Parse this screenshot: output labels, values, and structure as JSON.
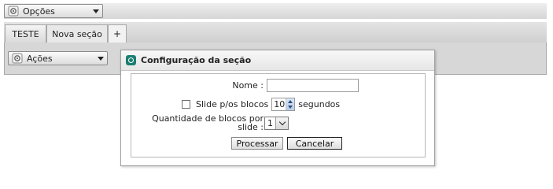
{
  "toolbar": {
    "options_label": "Opções"
  },
  "tabs": [
    {
      "label": "TESTE"
    },
    {
      "label": "Nova seção"
    },
    {
      "label": "+"
    }
  ],
  "panel": {
    "actions_label": "Ações"
  },
  "dialog": {
    "title": "Configuração da seção",
    "name_label": "Nome :",
    "name_value": "",
    "slide_label": "Slide p/os blocos",
    "slide_checked": false,
    "slide_seconds_value": "10",
    "slide_seconds_unit": "segundos",
    "blocks_per_slide_label": "Quantidade de blocos por slide :",
    "blocks_per_slide_value": "1",
    "process_button": "Processar",
    "cancel_button": "Cancelar"
  },
  "colors": {
    "dialog_icon": "#1b7f73",
    "spinner_arrow": "#2a4a80",
    "panel_bg": "#d7d7d7"
  },
  "icons": [
    "gear-icon",
    "chevron-down-icon",
    "dialog-app-icon",
    "spinner-up-icon",
    "spinner-down-icon"
  ]
}
